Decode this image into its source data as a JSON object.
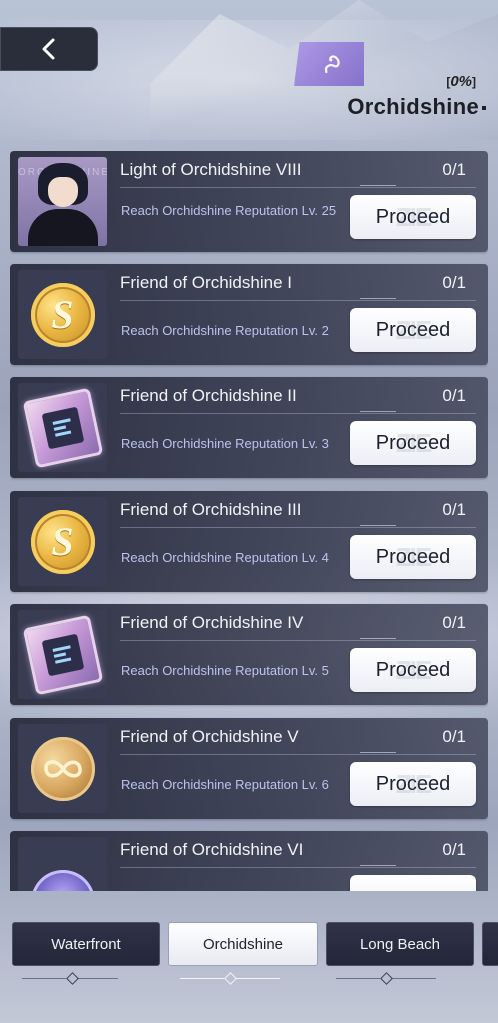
{
  "header": {
    "back_icon": "chevron-left-icon",
    "region_icon": "swan-emblem-icon",
    "progress_percent": "0%",
    "region_name": "Orchidshine"
  },
  "tasks": [
    {
      "title": "Light of Orchidshine VIII",
      "count": "0/1",
      "description": "Reach Orchidshine Reputation Lv. 25",
      "button": "Proceed",
      "reward_icon": "character-portrait-icon"
    },
    {
      "title": "Friend of Orchidshine I",
      "count": "0/1",
      "description": "Reach Orchidshine Reputation Lv. 2",
      "button": "Proceed",
      "reward_icon": "gold-coin-icon"
    },
    {
      "title": "Friend of Orchidshine II",
      "count": "0/1",
      "description": "Reach Orchidshine Reputation Lv. 3",
      "button": "Proceed",
      "reward_icon": "memory-chip-icon"
    },
    {
      "title": "Friend of Orchidshine III",
      "count": "0/1",
      "description": "Reach Orchidshine Reputation Lv. 4",
      "button": "Proceed",
      "reward_icon": "gold-coin-icon"
    },
    {
      "title": "Friend of Orchidshine IV",
      "count": "0/1",
      "description": "Reach Orchidshine Reputation Lv. 5",
      "button": "Proceed",
      "reward_icon": "memory-chip-icon"
    },
    {
      "title": "Friend of Orchidshine V",
      "count": "0/1",
      "description": "Reach Orchidshine Reputation Lv. 6",
      "button": "Proceed",
      "reward_icon": "infinity-token-icon"
    },
    {
      "title": "Friend of Orchidshine VI",
      "count": "0/1",
      "description": "",
      "button": "",
      "reward_icon": "purple-orb-icon"
    }
  ],
  "tabs": [
    {
      "label": "Waterfront",
      "active": false
    },
    {
      "label": "Orchidshine",
      "active": true
    },
    {
      "label": "Long Beach",
      "active": false
    }
  ],
  "colors": {
    "card_bg": "#272a3b",
    "accent_purple": "#8f79da",
    "description_text": "#bcc3ef"
  }
}
